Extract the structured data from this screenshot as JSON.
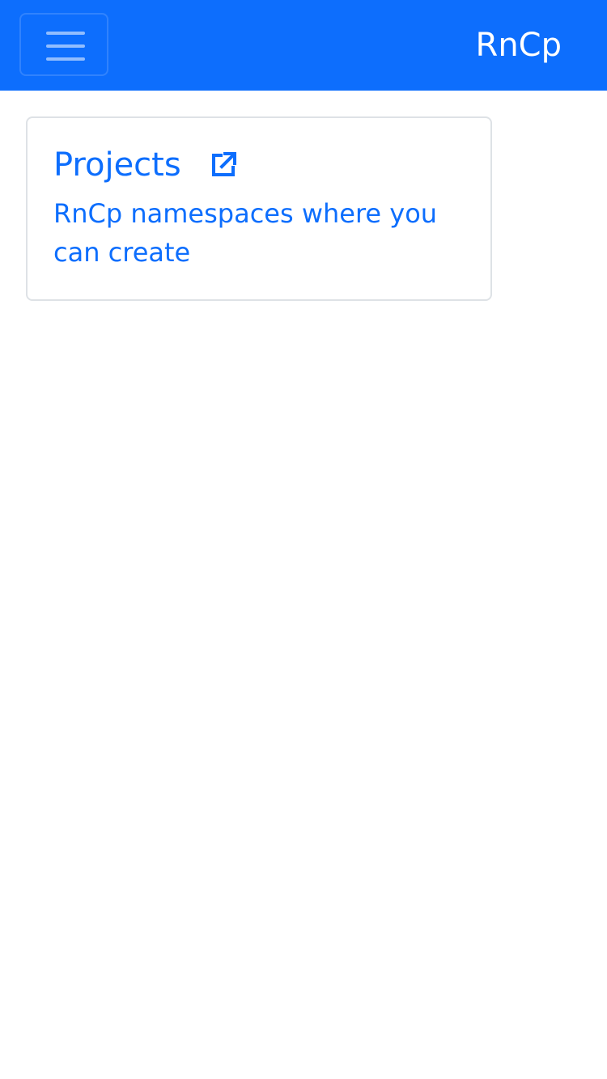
{
  "navbar": {
    "brand": "RnCp",
    "menu_icon": "hamburger-menu-icon",
    "background": "#0d6efd"
  },
  "card": {
    "title": "Projects",
    "title_icon": "external-link-icon",
    "description": "RnCp namespaces where you can create",
    "link_color": "#0d6efd"
  }
}
